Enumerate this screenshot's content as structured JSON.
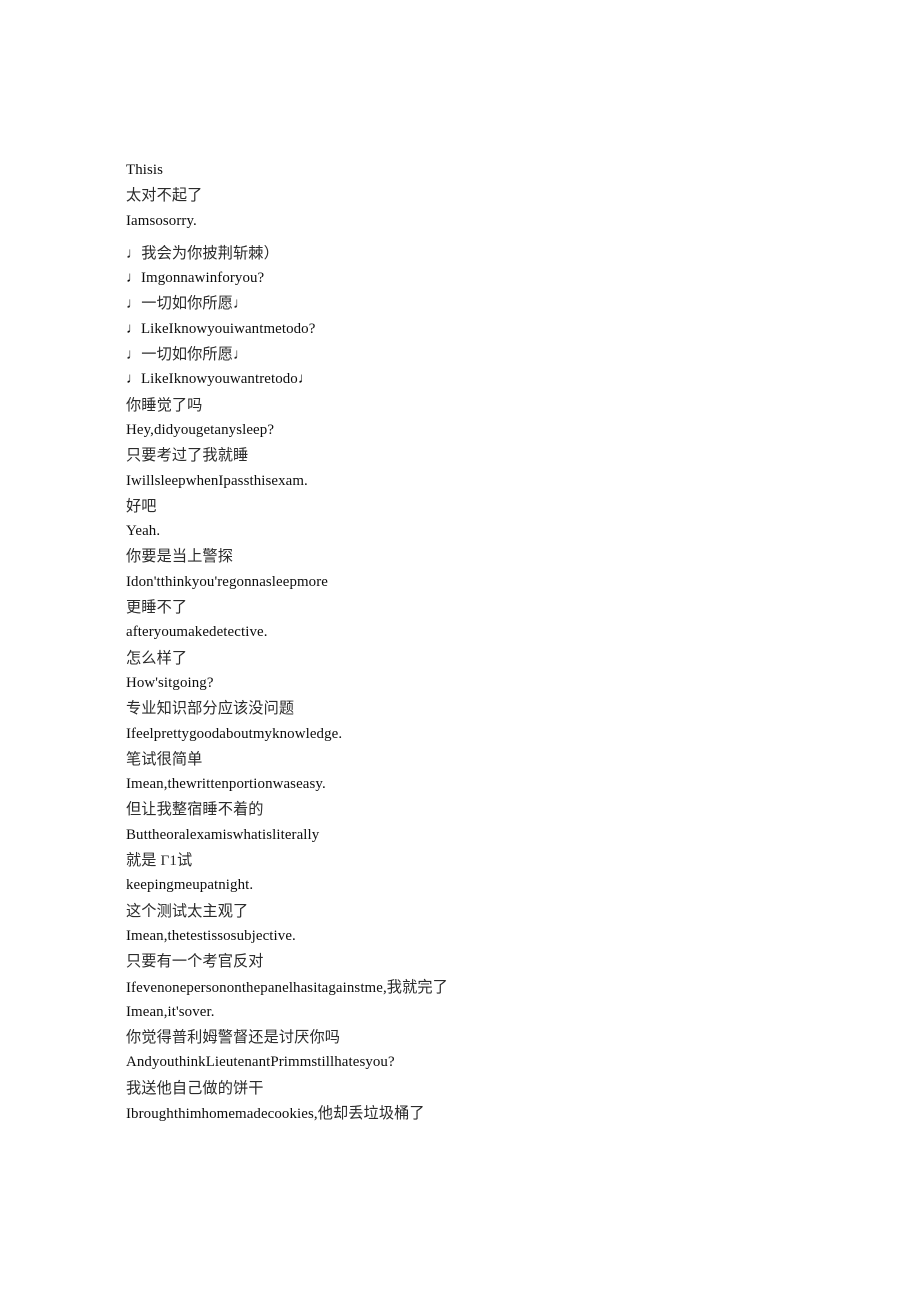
{
  "document": {
    "type": "bilingual-subtitle-transcript",
    "background_color": "#ffffff",
    "latin_text_color": "#0d0d0d",
    "han_text_color": "#2b2b2b",
    "lines": [
      {
        "text": "Thisis",
        "script": "lat",
        "gap_before": false
      },
      {
        "text": "太对不起了",
        "script": "han",
        "gap_before": false
      },
      {
        "text": "Iamsosorry.",
        "script": "lat",
        "gap_before": false
      },
      {
        "text": "♩我会为你披荆斩棘）",
        "script": "han",
        "gap_before": true
      },
      {
        "text": "♩Imgonnawinforyou?",
        "script": "lat",
        "gap_before": false
      },
      {
        "text": "♩一切如你所愿♩",
        "script": "han",
        "gap_before": false
      },
      {
        "text": "♩LikeIknowyouiwantmetodo?",
        "script": "lat",
        "gap_before": false
      },
      {
        "text": "♩一切如你所愿♩",
        "script": "han",
        "gap_before": false
      },
      {
        "text": "♩LikeIknowyouwantretodo♩",
        "script": "lat",
        "gap_before": false
      },
      {
        "text": "你睡觉了吗",
        "script": "han",
        "gap_before": false
      },
      {
        "text": "Hey,didyougetanysleep?",
        "script": "lat",
        "gap_before": false
      },
      {
        "text": "只要考过了我就睡",
        "script": "han",
        "gap_before": false
      },
      {
        "text": "IwillsleepwhenIpassthisexam.",
        "script": "lat",
        "gap_before": false
      },
      {
        "text": "好吧",
        "script": "han",
        "gap_before": false
      },
      {
        "text": "Yeah.",
        "script": "lat",
        "gap_before": false
      },
      {
        "text": "你要是当上警探",
        "script": "han",
        "gap_before": false
      },
      {
        "text": "Idon'tthinkyou'regonnasleepmore",
        "script": "lat",
        "gap_before": false
      },
      {
        "text": "更睡不了",
        "script": "han",
        "gap_before": false
      },
      {
        "text": "afteryoumakedetective.",
        "script": "lat",
        "gap_before": false
      },
      {
        "text": "怎么样了",
        "script": "han",
        "gap_before": false
      },
      {
        "text": "How'sitgoing?",
        "script": "lat",
        "gap_before": false
      },
      {
        "text": "专业知识部分应该没问题",
        "script": "han",
        "gap_before": false
      },
      {
        "text": "Ifeelprettygoodaboutmyknowledge.",
        "script": "lat",
        "gap_before": false
      },
      {
        "text": "笔试很简单",
        "script": "han",
        "gap_before": false
      },
      {
        "text": "Imean,thewrittenportionwaseasy.",
        "script": "lat",
        "gap_before": false
      },
      {
        "text": "但让我整宿睡不着的",
        "script": "han",
        "gap_before": false
      },
      {
        "text": "Buttheoralexamiswhatisliterally",
        "script": "lat",
        "gap_before": false
      },
      {
        "text": "就是 Γ1试",
        "script": "han",
        "gap_before": false
      },
      {
        "text": "keepingmeupatnight.",
        "script": "lat",
        "gap_before": false
      },
      {
        "text": "这个测试太主观了",
        "script": "han",
        "gap_before": false
      },
      {
        "text": "Imean,thetestissosubjective.",
        "script": "lat",
        "gap_before": false
      },
      {
        "text": "只要有一个考官反对",
        "script": "han",
        "gap_before": false
      },
      {
        "text": "Ifevenonepersononthepanelhasitagainstme,",
        "script": "mix",
        "han_tail": "我就完了",
        "gap_before": false
      },
      {
        "text": "Imean,it'sover.",
        "script": "lat",
        "gap_before": false
      },
      {
        "text": "你觉得普利姆警督还是讨厌你吗",
        "script": "han",
        "gap_before": false
      },
      {
        "text": "AndyouthinkLieutenantPrimmstillhatesyou?",
        "script": "lat",
        "gap_before": false
      },
      {
        "text": "我送他自己做的饼干",
        "script": "han",
        "gap_before": false
      },
      {
        "text": "Ibroughthimhomemadecookies,",
        "script": "mix",
        "han_tail": "他却丢垃圾桶了",
        "gap_before": false
      }
    ]
  }
}
